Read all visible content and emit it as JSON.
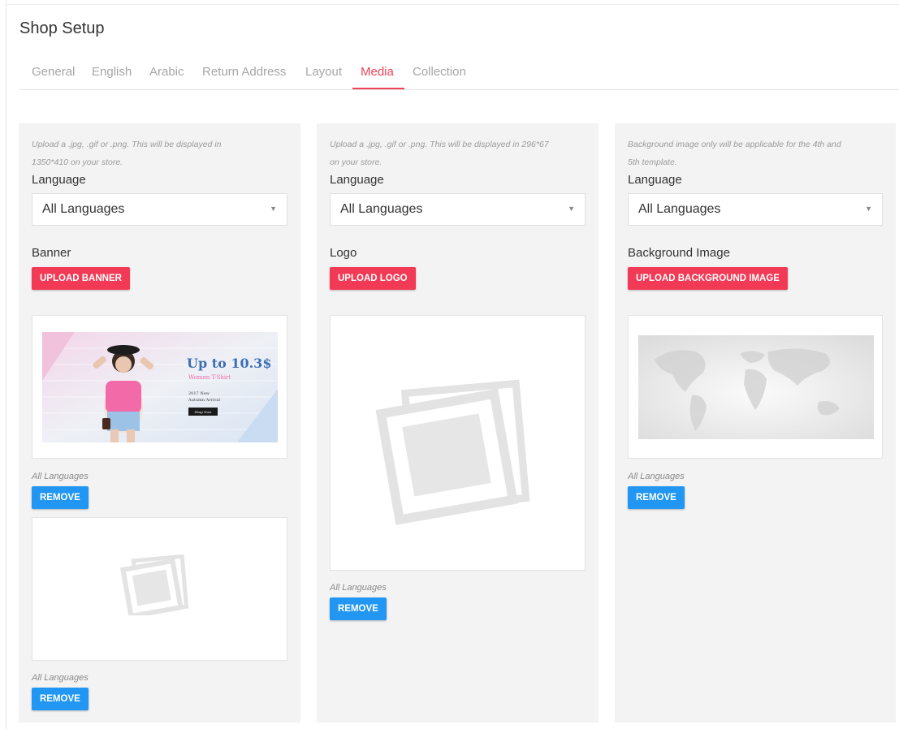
{
  "page": {
    "title": "Shop Setup"
  },
  "tabs": [
    {
      "label": "General"
    },
    {
      "label": "English"
    },
    {
      "label": "Arabic"
    },
    {
      "label": "Return Address"
    },
    {
      "label": "Layout"
    },
    {
      "label": "Media",
      "active": true
    },
    {
      "label": "Collection"
    }
  ],
  "banner_panel": {
    "hint_line1": "Upload a .jpg, .gif or .png. This will be displayed in",
    "hint_line2": "1350*410 on your store.",
    "language_label": "Language",
    "language_value": "All Languages",
    "section_label": "Banner",
    "upload_label": "UPLOAD BANNER",
    "images": [
      {
        "language": "All Languages",
        "remove_label": "REMOVE",
        "banner_text": {
          "headline": "Up to 10.3$",
          "subline": "Women T-Shirt",
          "note1": "2017 New",
          "note2": "Autumn Arrival",
          "cta": "Shop Now"
        }
      },
      {
        "language": "All Languages",
        "remove_label": "REMOVE"
      }
    ]
  },
  "logo_panel": {
    "hint_line1": "Upload a .jpg, .gif or .png. This will be displayed in 296*67",
    "hint_line2": "on your store.",
    "language_label": "Language",
    "language_value": "All Languages",
    "section_label": "Logo",
    "upload_label": "UPLOAD LOGO",
    "images": [
      {
        "language": "All Languages",
        "remove_label": "REMOVE"
      }
    ]
  },
  "background_panel": {
    "hint_line1": "Background image only will be applicable for the 4th and",
    "hint_line2": "5th template.",
    "language_label": "Language",
    "language_value": "All Languages",
    "section_label": "Background Image",
    "upload_label": "UPLOAD BACKGROUND IMAGE",
    "images": [
      {
        "language": "All Languages",
        "remove_label": "REMOVE"
      }
    ]
  },
  "colors": {
    "accent_pink": "#f23a56",
    "remove_blue": "#2196f3",
    "panel_bg": "#f3f3f3"
  }
}
